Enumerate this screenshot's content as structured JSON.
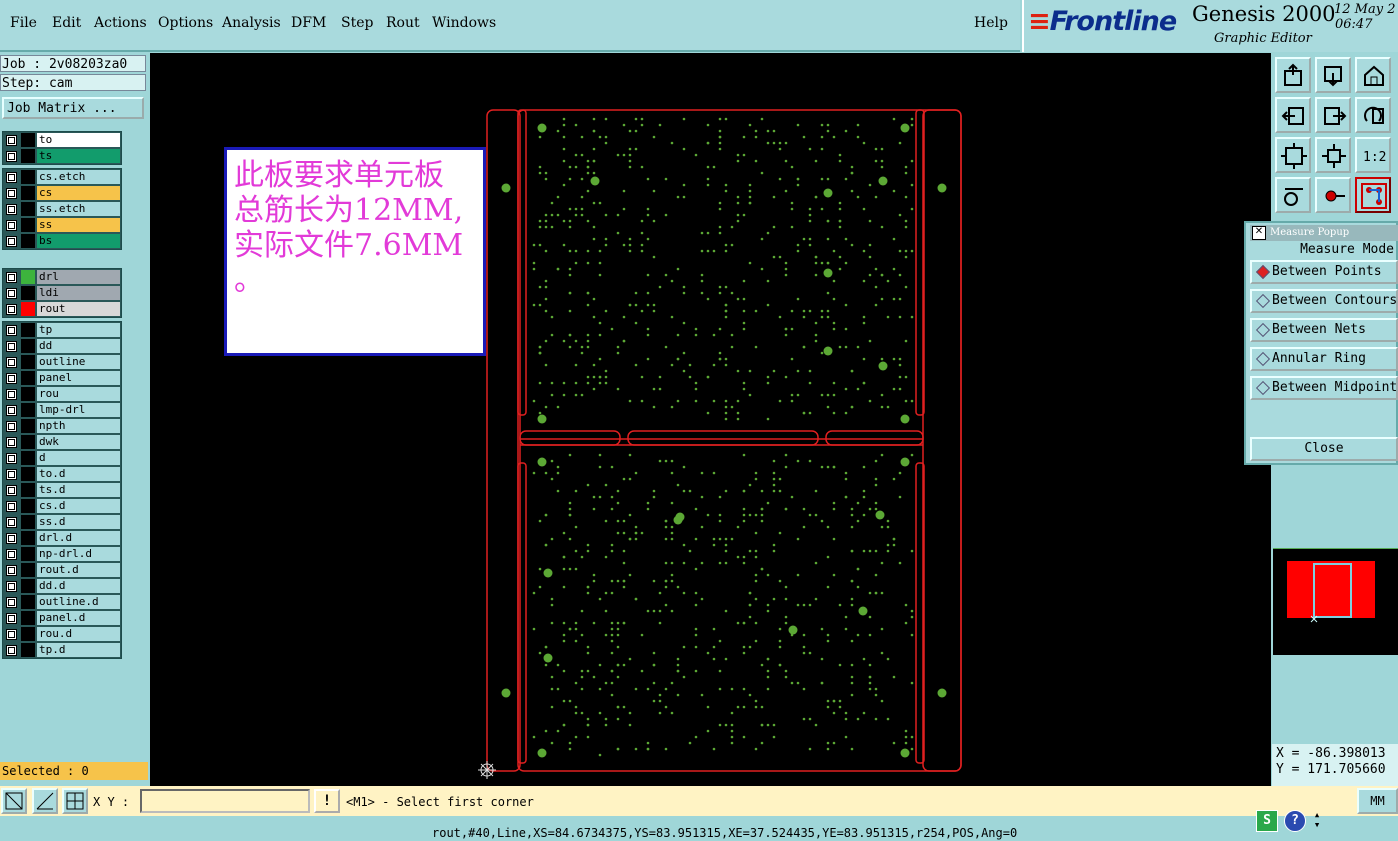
{
  "menu": {
    "items": [
      "File",
      "Edit",
      "Actions",
      "Options",
      "Analysis",
      "DFM",
      "Step",
      "Rout",
      "Windows"
    ],
    "help": "Help"
  },
  "brand": {
    "logo": "Frontline",
    "product": "Genesis 2000",
    "subtitle": "Graphic Editor",
    "date": "12 May 2",
    "time": "06:47"
  },
  "job": {
    "job_label": "Job : 2v08203za0",
    "step_label": "Step: cam",
    "matrix_button": "Job Matrix ..."
  },
  "layers_group1": [
    {
      "name": "to",
      "color": "#ffffff",
      "sw": "#000000"
    },
    {
      "name": "ts",
      "color": "#129c6c",
      "sw": "#000000"
    }
  ],
  "layers_group2": [
    {
      "name": "cs.etch",
      "color": "#a9dadd",
      "sw": "#000000"
    },
    {
      "name": "cs",
      "color": "#f6c34a",
      "sw": "#000000"
    },
    {
      "name": "ss.etch",
      "color": "#a9dadd",
      "sw": "#000000"
    },
    {
      "name": "ss",
      "color": "#f6c34a",
      "sw": "#000000"
    },
    {
      "name": "bs",
      "color": "#129c6c",
      "sw": "#000000"
    }
  ],
  "layers_group3": [
    {
      "name": "drl",
      "color": "#a0a8b0",
      "sw": "#3db43d"
    },
    {
      "name": "ldi",
      "color": "#a0a8b0",
      "sw": "#000000"
    },
    {
      "name": "rout",
      "color": "#d8d8d8",
      "sw": "#ff0000"
    }
  ],
  "layers_group4": [
    "tp",
    "dd",
    "outline",
    "panel",
    "rou",
    "lmp-drl",
    "npth",
    "dwk",
    "d",
    "to.d",
    "ts.d",
    "cs.d",
    "ss.d",
    "drl.d",
    "np-drl.d",
    "rout.d",
    "dd.d",
    "outline.d",
    "panel.d",
    "rou.d",
    "tp.d"
  ],
  "selected": "Selected : 0",
  "note": {
    "line1": "此板要求单元板",
    "line2": "总筋长为12MM,",
    "line3": "实际文件7.6MM",
    "line4": "。"
  },
  "measure": {
    "title": "Measure Popup",
    "mode_label": "Measure Mode",
    "options": [
      "Between Points",
      "Between Contours",
      "Between Nets",
      "Annular Ring",
      "Between Midpoints"
    ],
    "selected_index": 0,
    "close": "Close"
  },
  "coords": {
    "x": "X = -86.398013",
    "y": "Y = 171.705660"
  },
  "bottom": {
    "xy_label": "X Y :",
    "input_value": "",
    "prompt": "<M1> - Select first corner",
    "units": "MM"
  },
  "status_line": "rout,#40,Line,XS=84.6734375,YS=83.951315,XE=37.524435,YE=83.951315,r254,POS,Ang=0"
}
